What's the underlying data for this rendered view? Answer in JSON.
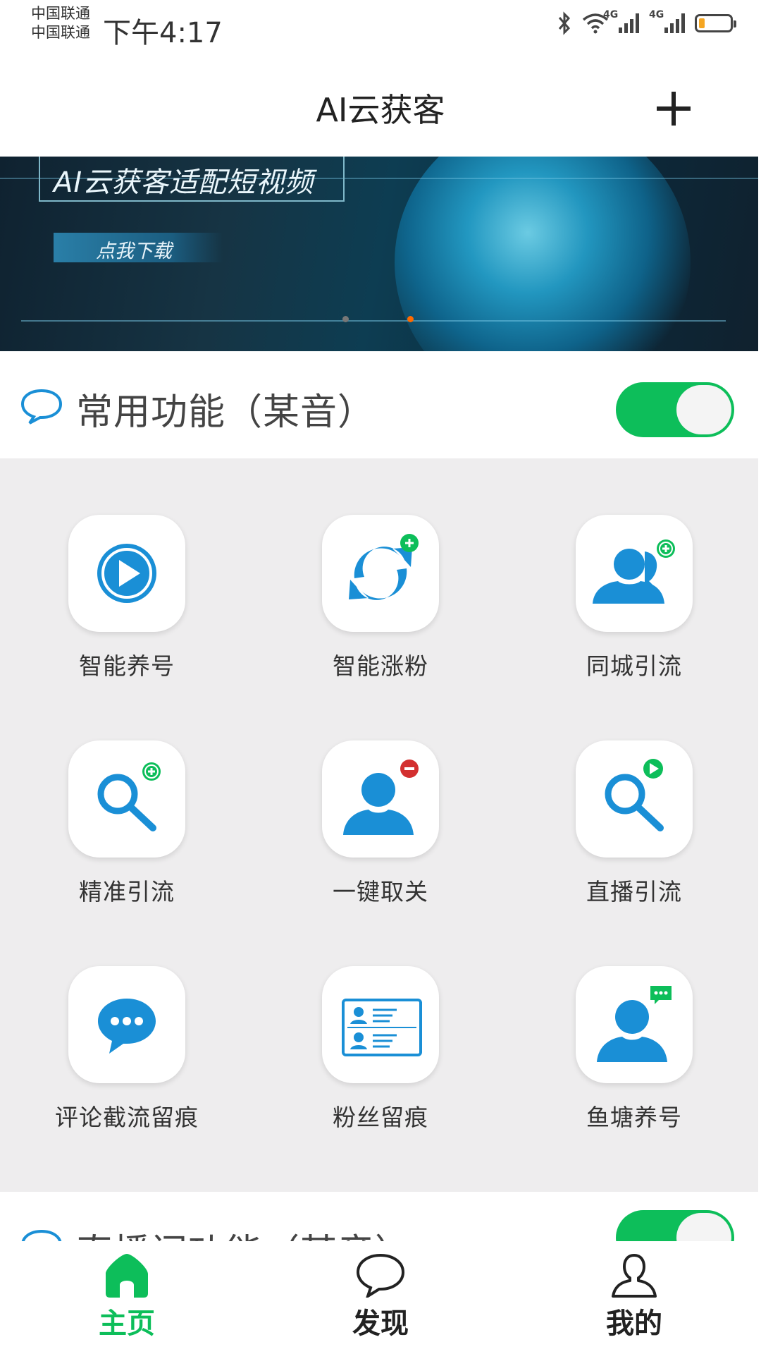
{
  "status_bar": {
    "carrier_1": "中国联通",
    "carrier_2": "中国联通",
    "time": "下午4:17",
    "network_1": "4G",
    "network_2": "4G",
    "icons": [
      "bluetooth-icon",
      "wifi-icon",
      "signal-icon",
      "signal-icon",
      "battery-icon"
    ],
    "battery_level": 0.2
  },
  "header": {
    "title": "AI云获客",
    "add_icon": "plus-icon"
  },
  "banner": {
    "headline": "AI云获客适配短视频",
    "button_label": "点我下载",
    "slide_count": 2,
    "active_slide": 2
  },
  "section_common": {
    "title": "常用功能（某音）",
    "toggle_on": true,
    "items": [
      {
        "label": "智能养号",
        "icon": "play-circle-icon"
      },
      {
        "label": "智能涨粉",
        "icon": "sync-plus-icon"
      },
      {
        "label": "同城引流",
        "icon": "users-plus-icon"
      },
      {
        "label": "精准引流",
        "icon": "search-plus-icon"
      },
      {
        "label": "一键取关",
        "icon": "user-minus-icon"
      },
      {
        "label": "直播引流",
        "icon": "search-play-icon"
      },
      {
        "label": "评论截流留痕",
        "icon": "chat-bubble-icon"
      },
      {
        "label": "粉丝留痕",
        "icon": "contact-card-icon"
      },
      {
        "label": "鱼塘养号",
        "icon": "user-message-icon"
      }
    ]
  },
  "section_live": {
    "title": "直播间功能（某音）",
    "toggle_on": true
  },
  "bottom_nav": [
    {
      "label": "主页",
      "icon": "home-icon",
      "active": true
    },
    {
      "label": "发现",
      "icon": "chat-icon",
      "active": false
    },
    {
      "label": "我的",
      "icon": "person-icon",
      "active": false
    }
  ],
  "colors": {
    "accent_green": "#0dbe5a",
    "icon_blue": "#1a8fd6",
    "grid_bg": "#eeedee"
  }
}
